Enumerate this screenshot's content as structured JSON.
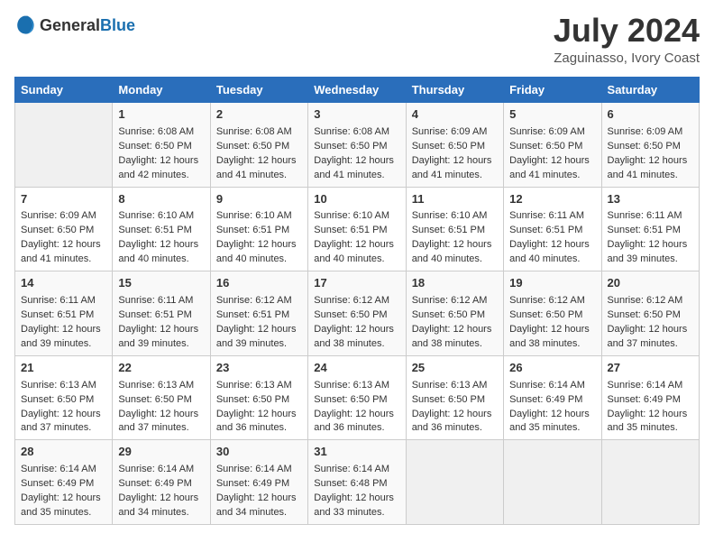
{
  "logo": {
    "general": "General",
    "blue": "Blue"
  },
  "header": {
    "month": "July 2024",
    "location": "Zaguinasso, Ivory Coast"
  },
  "days": {
    "headers": [
      "Sunday",
      "Monday",
      "Tuesday",
      "Wednesday",
      "Thursday",
      "Friday",
      "Saturday"
    ]
  },
  "weeks": [
    [
      {
        "num": "",
        "empty": true
      },
      {
        "num": "1",
        "sunrise": "6:08 AM",
        "sunset": "6:50 PM",
        "daylight": "12 hours and 42 minutes."
      },
      {
        "num": "2",
        "sunrise": "6:08 AM",
        "sunset": "6:50 PM",
        "daylight": "12 hours and 41 minutes."
      },
      {
        "num": "3",
        "sunrise": "6:08 AM",
        "sunset": "6:50 PM",
        "daylight": "12 hours and 41 minutes."
      },
      {
        "num": "4",
        "sunrise": "6:09 AM",
        "sunset": "6:50 PM",
        "daylight": "12 hours and 41 minutes."
      },
      {
        "num": "5",
        "sunrise": "6:09 AM",
        "sunset": "6:50 PM",
        "daylight": "12 hours and 41 minutes."
      },
      {
        "num": "6",
        "sunrise": "6:09 AM",
        "sunset": "6:50 PM",
        "daylight": "12 hours and 41 minutes."
      }
    ],
    [
      {
        "num": "7",
        "sunrise": "6:09 AM",
        "sunset": "6:50 PM",
        "daylight": "12 hours and 41 minutes."
      },
      {
        "num": "8",
        "sunrise": "6:10 AM",
        "sunset": "6:51 PM",
        "daylight": "12 hours and 40 minutes."
      },
      {
        "num": "9",
        "sunrise": "6:10 AM",
        "sunset": "6:51 PM",
        "daylight": "12 hours and 40 minutes."
      },
      {
        "num": "10",
        "sunrise": "6:10 AM",
        "sunset": "6:51 PM",
        "daylight": "12 hours and 40 minutes."
      },
      {
        "num": "11",
        "sunrise": "6:10 AM",
        "sunset": "6:51 PM",
        "daylight": "12 hours and 40 minutes."
      },
      {
        "num": "12",
        "sunrise": "6:11 AM",
        "sunset": "6:51 PM",
        "daylight": "12 hours and 40 minutes."
      },
      {
        "num": "13",
        "sunrise": "6:11 AM",
        "sunset": "6:51 PM",
        "daylight": "12 hours and 39 minutes."
      }
    ],
    [
      {
        "num": "14",
        "sunrise": "6:11 AM",
        "sunset": "6:51 PM",
        "daylight": "12 hours and 39 minutes."
      },
      {
        "num": "15",
        "sunrise": "6:11 AM",
        "sunset": "6:51 PM",
        "daylight": "12 hours and 39 minutes."
      },
      {
        "num": "16",
        "sunrise": "6:12 AM",
        "sunset": "6:51 PM",
        "daylight": "12 hours and 39 minutes."
      },
      {
        "num": "17",
        "sunrise": "6:12 AM",
        "sunset": "6:50 PM",
        "daylight": "12 hours and 38 minutes."
      },
      {
        "num": "18",
        "sunrise": "6:12 AM",
        "sunset": "6:50 PM",
        "daylight": "12 hours and 38 minutes."
      },
      {
        "num": "19",
        "sunrise": "6:12 AM",
        "sunset": "6:50 PM",
        "daylight": "12 hours and 38 minutes."
      },
      {
        "num": "20",
        "sunrise": "6:12 AM",
        "sunset": "6:50 PM",
        "daylight": "12 hours and 37 minutes."
      }
    ],
    [
      {
        "num": "21",
        "sunrise": "6:13 AM",
        "sunset": "6:50 PM",
        "daylight": "12 hours and 37 minutes."
      },
      {
        "num": "22",
        "sunrise": "6:13 AM",
        "sunset": "6:50 PM",
        "daylight": "12 hours and 37 minutes."
      },
      {
        "num": "23",
        "sunrise": "6:13 AM",
        "sunset": "6:50 PM",
        "daylight": "12 hours and 36 minutes."
      },
      {
        "num": "24",
        "sunrise": "6:13 AM",
        "sunset": "6:50 PM",
        "daylight": "12 hours and 36 minutes."
      },
      {
        "num": "25",
        "sunrise": "6:13 AM",
        "sunset": "6:50 PM",
        "daylight": "12 hours and 36 minutes."
      },
      {
        "num": "26",
        "sunrise": "6:14 AM",
        "sunset": "6:49 PM",
        "daylight": "12 hours and 35 minutes."
      },
      {
        "num": "27",
        "sunrise": "6:14 AM",
        "sunset": "6:49 PM",
        "daylight": "12 hours and 35 minutes."
      }
    ],
    [
      {
        "num": "28",
        "sunrise": "6:14 AM",
        "sunset": "6:49 PM",
        "daylight": "12 hours and 35 minutes."
      },
      {
        "num": "29",
        "sunrise": "6:14 AM",
        "sunset": "6:49 PM",
        "daylight": "12 hours and 34 minutes."
      },
      {
        "num": "30",
        "sunrise": "6:14 AM",
        "sunset": "6:49 PM",
        "daylight": "12 hours and 34 minutes."
      },
      {
        "num": "31",
        "sunrise": "6:14 AM",
        "sunset": "6:48 PM",
        "daylight": "12 hours and 33 minutes."
      },
      {
        "num": "",
        "empty": true
      },
      {
        "num": "",
        "empty": true
      },
      {
        "num": "",
        "empty": true
      }
    ]
  ],
  "labels": {
    "sunrise": "Sunrise:",
    "sunset": "Sunset:",
    "daylight": "Daylight:"
  }
}
